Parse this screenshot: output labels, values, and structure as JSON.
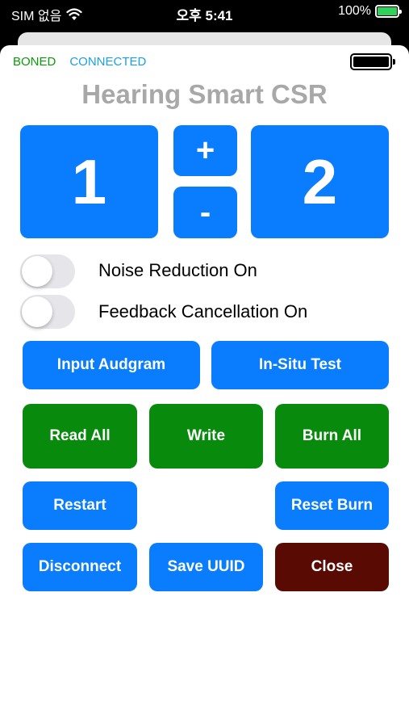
{
  "statusbar": {
    "carrier": "SIM 없음",
    "time": "오후 5:41",
    "battery": "100%"
  },
  "status": {
    "boned": "BONED",
    "connected": "CONNECTED"
  },
  "title": "Hearing Smart CSR",
  "memory": {
    "left_value": "1",
    "plus": "+",
    "minus": "-",
    "right_value": "2"
  },
  "toggles": [
    {
      "label": "Noise Reduction On",
      "on": false
    },
    {
      "label": "Feedback Cancellation On",
      "on": false
    }
  ],
  "buttons": {
    "input_audgram": "Input Audgram",
    "in_situ_test": "In-Situ Test",
    "read_all": "Read All",
    "write": "Write",
    "burn_all": "Burn All",
    "restart": "Restart",
    "reset_burn": "Reset Burn",
    "disconnect": "Disconnect",
    "save_uuid": "Save UUID",
    "close": "Close"
  },
  "colors": {
    "blue": "#0a7cfe",
    "green": "#088a0c",
    "close": "#590b03",
    "boned": "#0a9a0a",
    "connected": "#1aa0e6"
  }
}
